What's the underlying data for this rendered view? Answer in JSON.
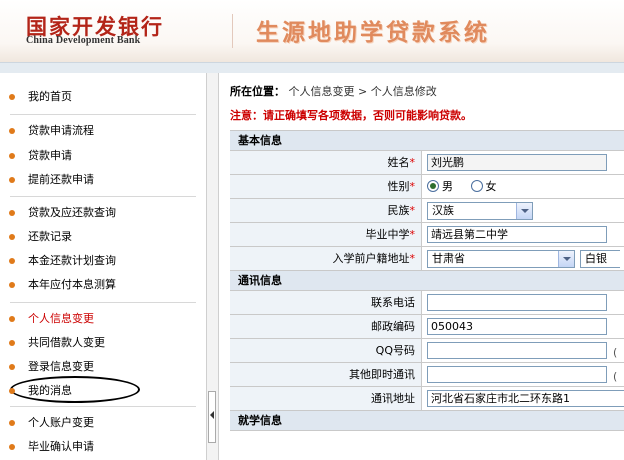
{
  "header": {
    "logo_cn": "国家开发银行",
    "logo_en": "China Development Bank",
    "system_title": "生源地助学贷款系统",
    "brand_color": "#b32418"
  },
  "sidebar": {
    "items": [
      {
        "label": "我的首页"
      },
      {
        "label": "贷款申请流程"
      },
      {
        "label": "贷款申请"
      },
      {
        "label": "提前还款申请"
      },
      {
        "label": "贷款及应还款查询"
      },
      {
        "label": "还款记录"
      },
      {
        "label": "本金还款计划查询"
      },
      {
        "label": "本年应付本息测算"
      },
      {
        "label": "个人信息变更",
        "active": true
      },
      {
        "label": "共同借款人变更"
      },
      {
        "label": "登录信息变更"
      },
      {
        "label": "我的消息"
      },
      {
        "label": "个人账户变更"
      },
      {
        "label": "毕业确认申请"
      }
    ],
    "bullet_color": "#e07a1a"
  },
  "breadcrumb": {
    "prefix": "所在位置：",
    "path": "个人信息变更 > 个人信息修改"
  },
  "warning": "注意：请正确填写各项数据，否则可能影响贷款。",
  "form": {
    "basic_section": "基本信息",
    "name_label": "姓名",
    "name_value": "刘光鹏",
    "gender_label": "性别",
    "gender_male": "男",
    "gender_female": "女",
    "ethnicity_label": "民族",
    "ethnicity_value": "汉族",
    "school_label": "毕业中学",
    "school_value": "靖远县第二中学",
    "hukou_label": "入学前户籍地址",
    "hukou_province": "甘肃省",
    "hukou_city_partial": "白银",
    "contact_section": "通讯信息",
    "phone_label": "联系电话",
    "phone_value": "",
    "postcode_label": "邮政编码",
    "postcode_value": "050043",
    "qq_label": "QQ号码",
    "qq_value": "",
    "im_label": "其他即时通讯",
    "im_value": "",
    "address_label": "通讯地址",
    "address_value": "河北省石家庄市北二环东路1",
    "study_section": "就学信息",
    "required_mark": "*"
  }
}
